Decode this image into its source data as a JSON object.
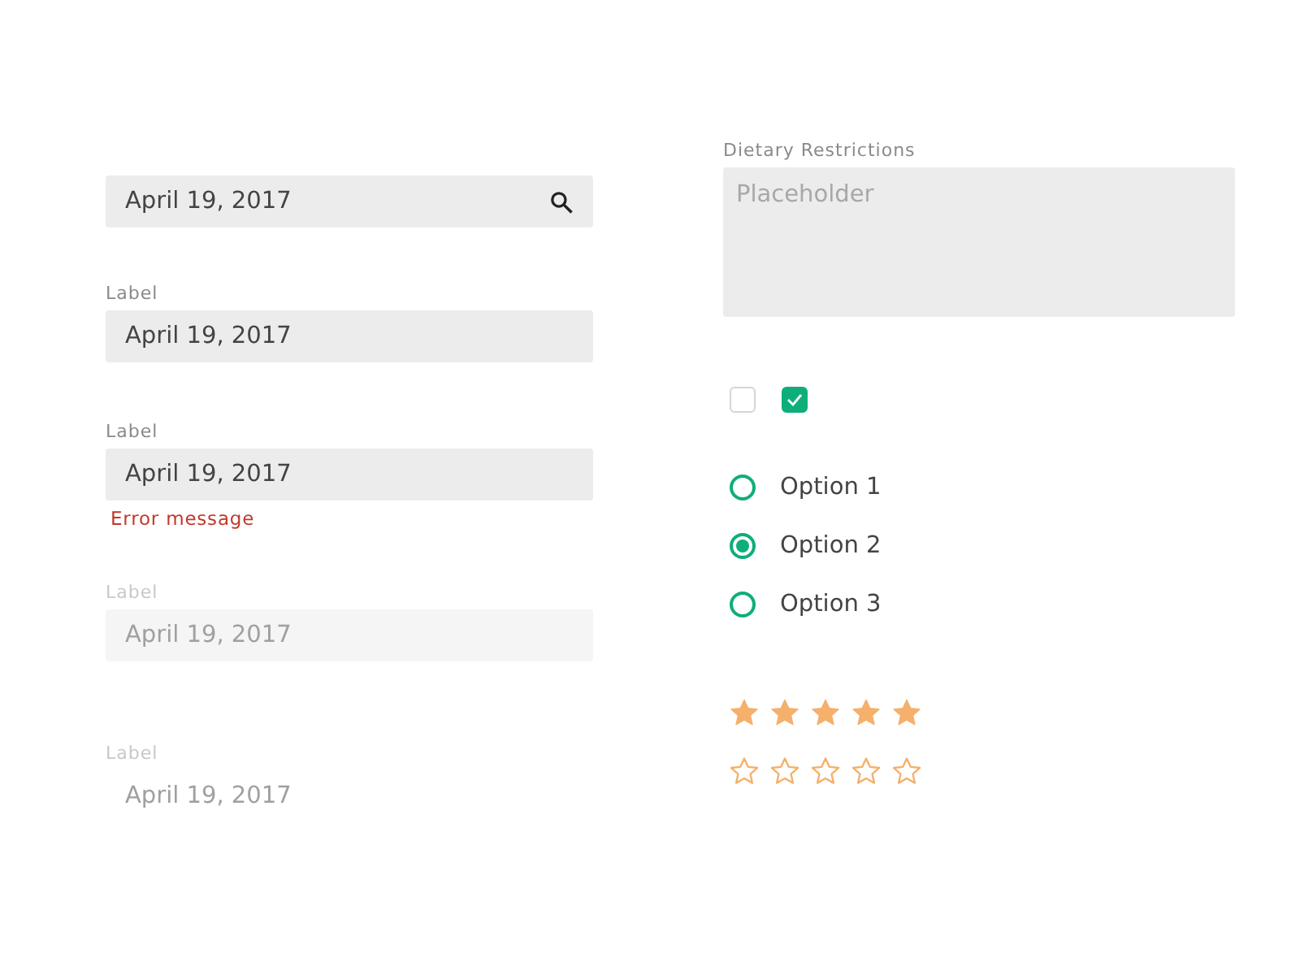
{
  "fields": [
    {
      "kind": "search",
      "value": "April 19, 2017"
    },
    {
      "kind": "default",
      "label": "Label",
      "value": "April 19, 2017"
    },
    {
      "kind": "error",
      "label": "Label",
      "value": "April 19, 2017",
      "error": "Error message"
    },
    {
      "kind": "disabled",
      "label": "Label",
      "value": "April 19, 2017"
    },
    {
      "kind": "borderless",
      "label": "Label",
      "value": "April 19, 2017"
    }
  ],
  "textarea": {
    "label": "Dietary Restrictions",
    "placeholder": "Placeholder"
  },
  "checkboxes": [
    {
      "checked": false
    },
    {
      "checked": true
    }
  ],
  "radios": [
    {
      "label": "Option 1",
      "selected": false
    },
    {
      "label": "Option 2",
      "selected": true
    },
    {
      "label": "Option 3",
      "selected": false
    }
  ],
  "ratings": [
    {
      "stars": 5
    },
    {
      "stars": 0
    }
  ]
}
